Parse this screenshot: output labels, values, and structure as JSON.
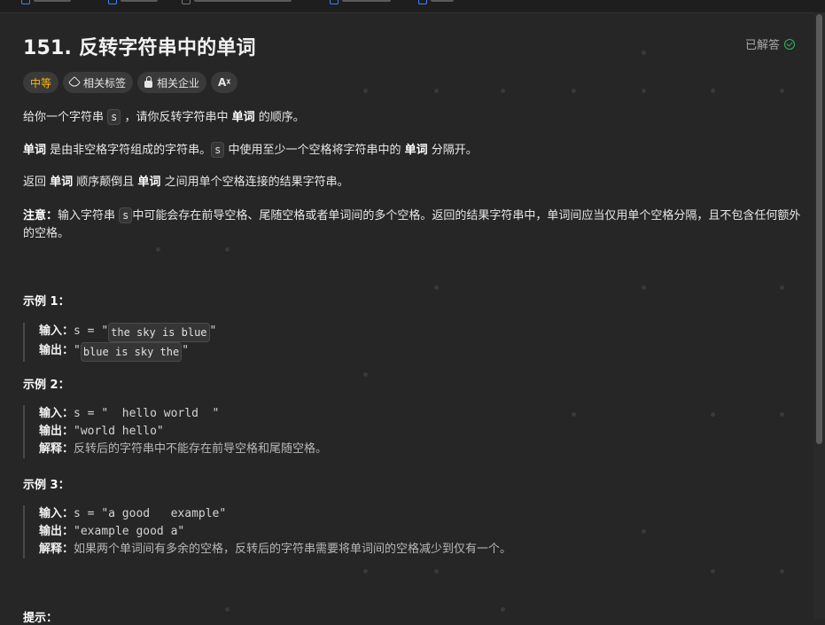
{
  "problem": {
    "title": "151. 反转字符串中的单词",
    "solved_label": "已解答",
    "tags": {
      "difficulty": "中等",
      "related_tags": "相关标签",
      "related_companies": "相关企业",
      "translate": "Aᵡ"
    }
  },
  "description": {
    "p1": {
      "a": "给你一个字符串 ",
      "code": "s",
      "b": " ，请你反转字符串中 ",
      "bold": "单词",
      "c": " 的顺序。"
    },
    "p2": {
      "bold1": "单词",
      "a": " 是由非空格字符组成的字符串。",
      "code": "s",
      "b": " 中使用至少一个空格将字符串中的 ",
      "bold2": "单词",
      "c": " 分隔开。"
    },
    "p3": {
      "a": "返回 ",
      "bold1": "单词",
      "b": " 顺序颠倒且 ",
      "bold2": "单词",
      "c": " 之间用单个空格连接的结果字符串。"
    },
    "p4": {
      "bold": "注意：",
      "a": "输入字符串 ",
      "code": "s",
      "b": "中可能会存在前导空格、尾随空格或者单词间的多个空格。返回的结果字符串中，单词间应当仅用单个空格分隔，且不包含任何额外的空格。"
    }
  },
  "examples": [
    {
      "title": "示例 1：",
      "input_label": "输入：",
      "input_prefix": "s = \"",
      "input_code": "the sky is blue",
      "input_suffix": "\"",
      "output_label": "输出：",
      "output_prefix": "\"",
      "output_code": "blue is sky the",
      "output_suffix": "\""
    },
    {
      "title": "示例 2：",
      "input_label": "输入：",
      "input_value": "s = \"  hello world  \"",
      "output_label": "输出：",
      "output_value": "\"world hello\"",
      "explain_label": "解释：",
      "explain_value": "反转后的字符串中不能存在前导空格和尾随空格。"
    },
    {
      "title": "示例 3：",
      "input_label": "输入：",
      "input_value": "s = \"a good   example\"",
      "output_label": "输出：",
      "output_value": "\"example good a\"",
      "explain_label": "解释：",
      "explain_value": "如果两个单词间有多余的空格，反转后的字符串需要将单词间的空格减少到仅有一个。"
    }
  ],
  "hints_title": "提示："
}
